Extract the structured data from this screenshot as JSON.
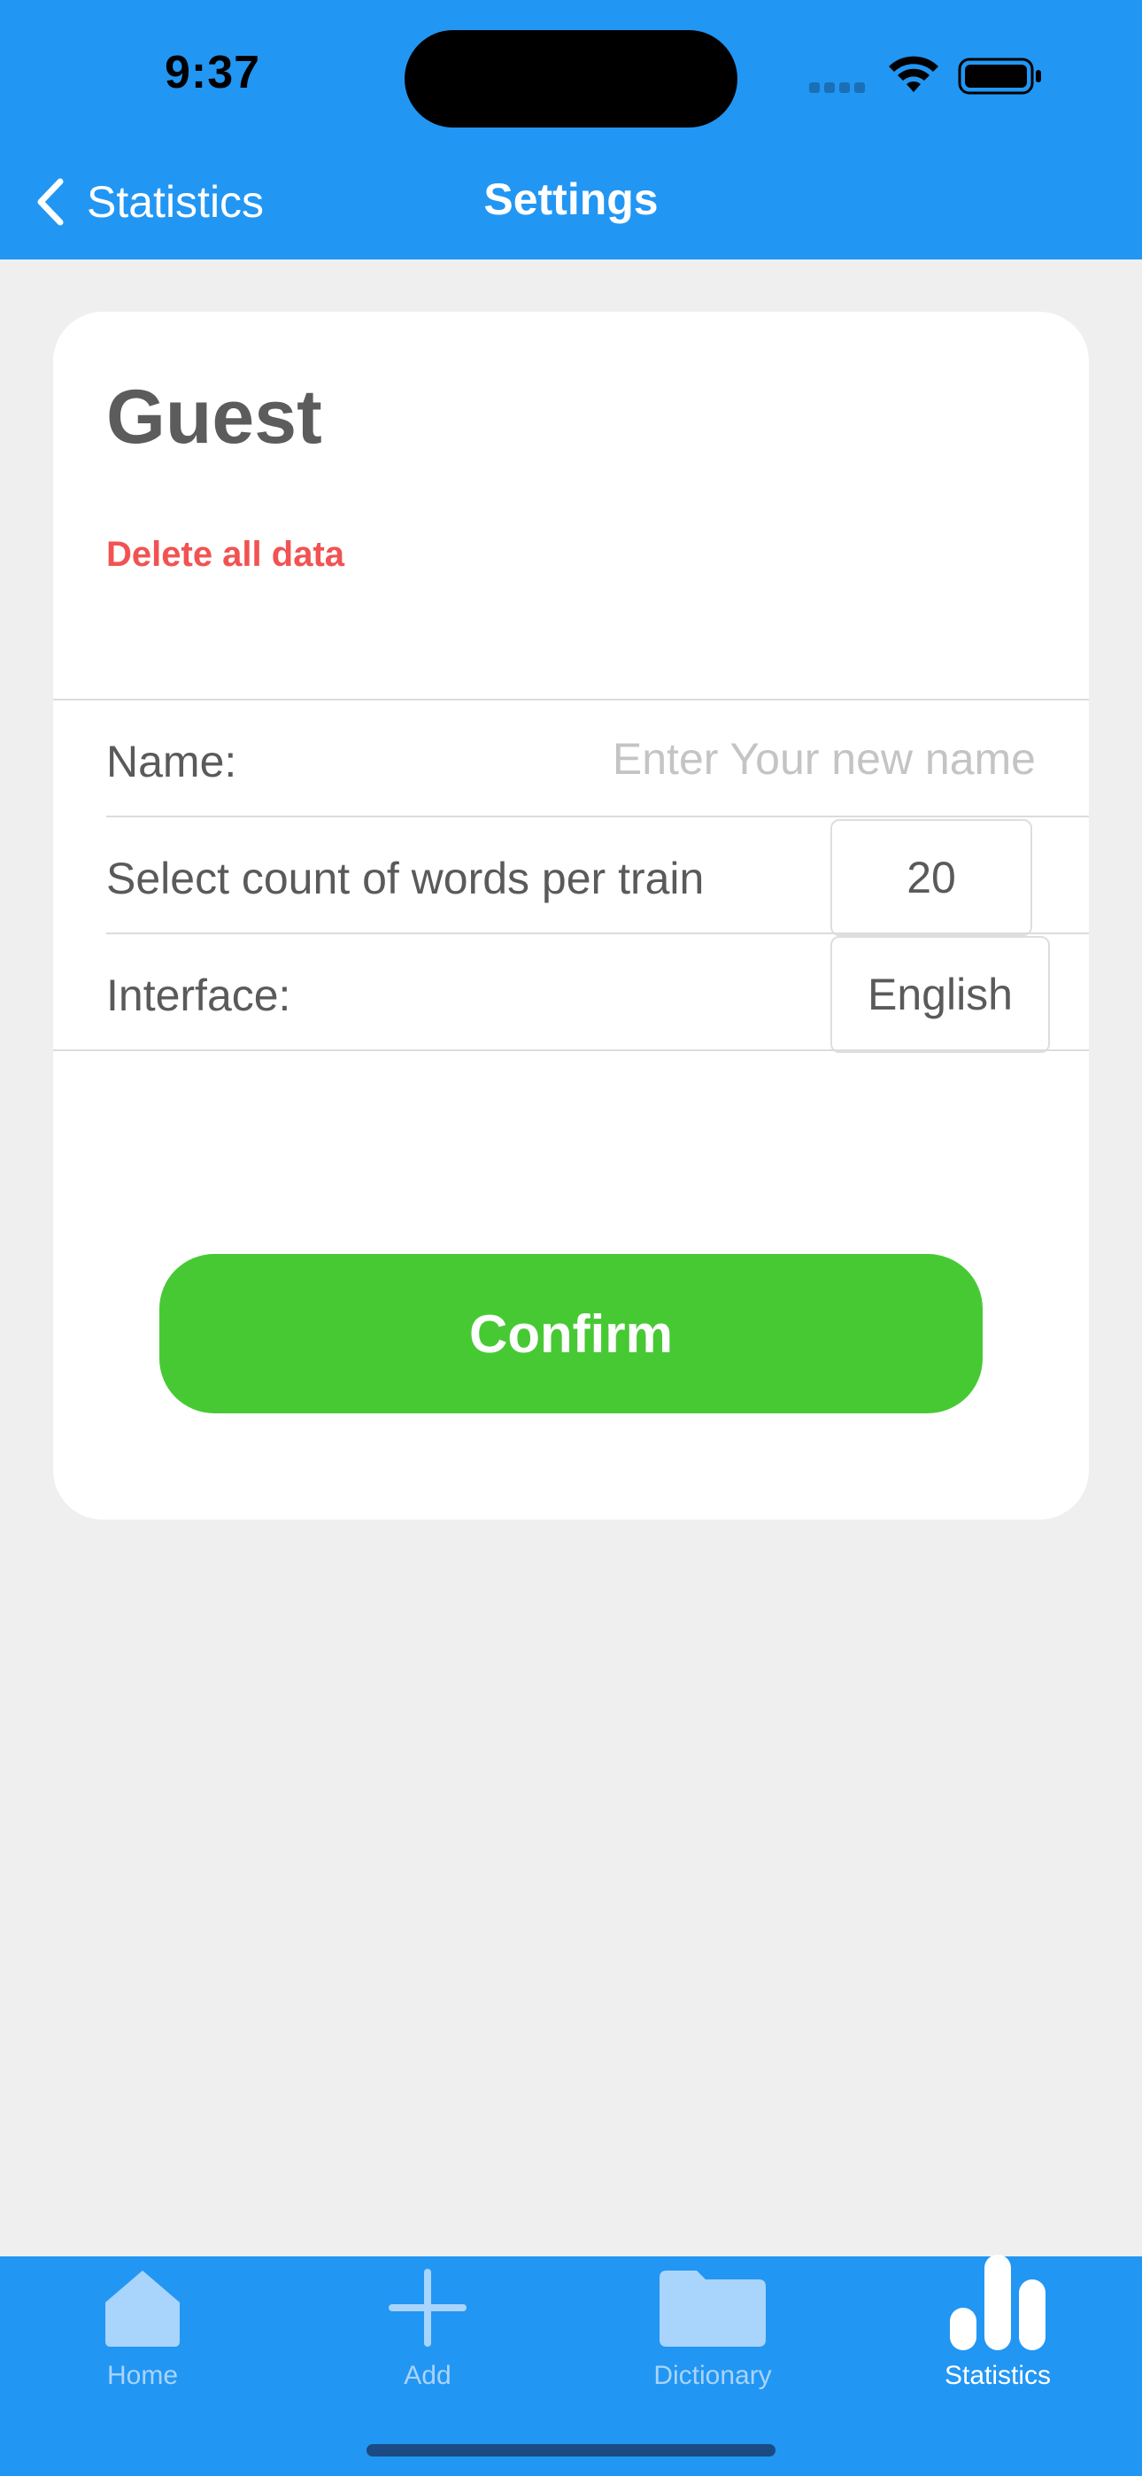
{
  "status_bar": {
    "time": "9:37"
  },
  "nav": {
    "back_label": "Statistics",
    "title": "Settings"
  },
  "profile": {
    "name": "Guest",
    "delete_label": "Delete all data"
  },
  "settings": {
    "name_label": "Name:",
    "name_placeholder": "Enter Your new name",
    "name_value": "",
    "words_label": "Select count of words per train",
    "words_value": "20",
    "interface_label": "Interface:",
    "interface_value": "English"
  },
  "confirm_label": "Confirm",
  "tabs": [
    {
      "label": "Home",
      "icon": "home-icon",
      "active": false
    },
    {
      "label": "Add",
      "icon": "plus-icon",
      "active": false
    },
    {
      "label": "Dictionary",
      "icon": "folder-icon",
      "active": false
    },
    {
      "label": "Statistics",
      "icon": "bar-chart-icon",
      "active": true
    }
  ],
  "colors": {
    "header": "#2296f3",
    "confirm": "#47c934",
    "danger": "#f25252",
    "background": "#efefef"
  }
}
